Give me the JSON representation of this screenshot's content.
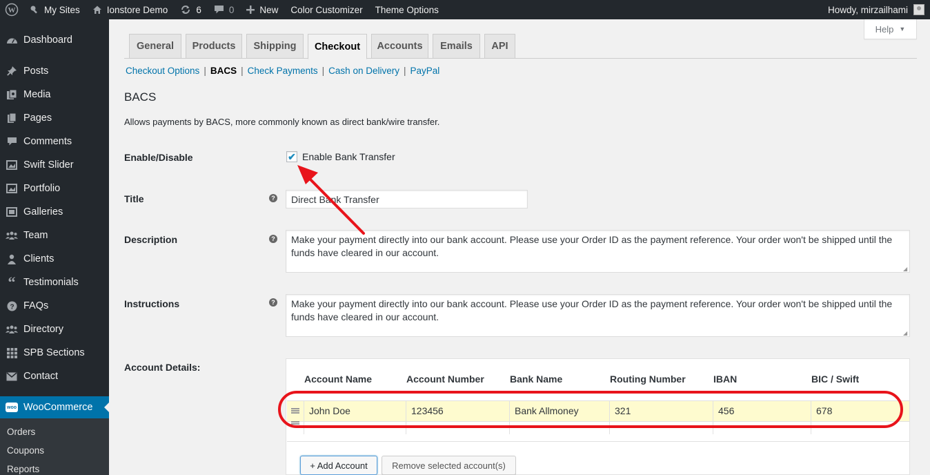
{
  "adminbar": {
    "my_sites": "My Sites",
    "site_name": "Ionstore Demo",
    "updates_count": "6",
    "comments_count": "0",
    "new_label": "New",
    "color_customizer": "Color Customizer",
    "theme_options": "Theme Options",
    "howdy": "Howdy, mirzailhami"
  },
  "sidebar": {
    "items": [
      {
        "label": "Dashboard",
        "icon": "dashboard-icon"
      },
      {
        "label": "Posts",
        "icon": "pin-icon"
      },
      {
        "label": "Media",
        "icon": "media-icon"
      },
      {
        "label": "Pages",
        "icon": "pages-icon"
      },
      {
        "label": "Comments",
        "icon": "comments-icon"
      },
      {
        "label": "Swift Slider",
        "icon": "slider-icon"
      },
      {
        "label": "Portfolio",
        "icon": "portfolio-icon"
      },
      {
        "label": "Galleries",
        "icon": "galleries-icon"
      },
      {
        "label": "Team",
        "icon": "team-icon"
      },
      {
        "label": "Clients",
        "icon": "clients-icon"
      },
      {
        "label": "Testimonials",
        "icon": "quote-icon"
      },
      {
        "label": "FAQs",
        "icon": "help-icon"
      },
      {
        "label": "Directory",
        "icon": "directory-icon"
      },
      {
        "label": "SPB Sections",
        "icon": "grid-icon"
      },
      {
        "label": "Contact",
        "icon": "mail-icon"
      },
      {
        "label": "WooCommerce",
        "icon": "woo-icon"
      }
    ],
    "woo_badge": "woo",
    "submenu": [
      "Orders",
      "Coupons",
      "Reports"
    ]
  },
  "help": {
    "label": "Help"
  },
  "tabs": [
    "General",
    "Products",
    "Shipping",
    "Checkout",
    "Accounts",
    "Emails",
    "API"
  ],
  "active_tab": "Checkout",
  "subsub": {
    "checkout_options": "Checkout Options",
    "bacs": "BACS",
    "check_payments": "Check Payments",
    "cod": "Cash on Delivery",
    "paypal": "PayPal"
  },
  "section": {
    "title": "BACS",
    "description": "Allows payments by BACS, more commonly known as direct bank/wire transfer."
  },
  "form": {
    "enable_label": "Enable/Disable",
    "enable_checkbox_label": "Enable Bank Transfer",
    "enable_checked": true,
    "title_label": "Title",
    "title_value": "Direct Bank Transfer",
    "description_label": "Description",
    "description_value": "Make your payment directly into our bank account. Please use your Order ID as the payment reference. Your order won't be shipped until the funds have cleared in our account.",
    "instructions_label": "Instructions",
    "instructions_value": "Make your payment directly into our bank account. Please use your Order ID as the payment reference. Your order won't be shipped until the funds have cleared in our account.",
    "account_details_label": "Account Details:"
  },
  "accounts": {
    "headers": [
      "Account Name",
      "Account Number",
      "Bank Name",
      "Routing Number",
      "IBAN",
      "BIC / Swift"
    ],
    "rows": [
      [
        "John Doe",
        "123456",
        "Bank Allmoney",
        "321",
        "456",
        "678"
      ],
      [
        "",
        "",
        "",
        "",
        "",
        ""
      ]
    ],
    "add_button": "+ Add Account",
    "remove_button": "Remove selected account(s)"
  },
  "annotation_color": "#e8141b"
}
